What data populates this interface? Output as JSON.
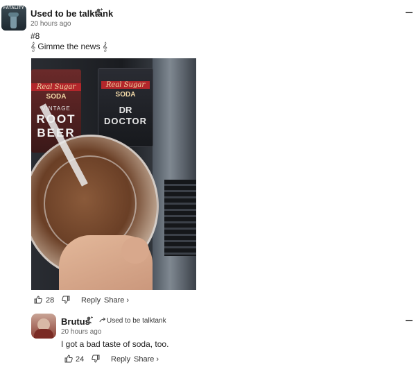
{
  "top_comment": {
    "username": "Used to be talktank",
    "timestamp": "20 hours ago",
    "line1": "#8",
    "line2": "𝄞 Gimme the news 𝄞",
    "avatar_text": "FATALITY",
    "likes": "28",
    "reply_label": "Reply",
    "share_label": "Share ›"
  },
  "photo": {
    "left_label_1": "Real Sugar",
    "left_label_2": "SODA",
    "left_label_3": "VINTAGE",
    "left_label_4": "ROOT",
    "left_label_5": "BEER",
    "right_label_1": "Real Sugar",
    "right_label_2": "SODA",
    "right_label_3": "DR",
    "right_label_4": "DOCTOR"
  },
  "reply_comment": {
    "username": "Brutus",
    "replying_to": "Used to be talktank",
    "timestamp": "20 hours ago",
    "text": "I got a bad taste of soda, too.",
    "likes": "24",
    "reply_label": "Reply",
    "share_label": "Share ›"
  },
  "colors": {
    "accent": "#1a1a1a",
    "muted": "#666666",
    "soda_red": "#b3262b"
  }
}
